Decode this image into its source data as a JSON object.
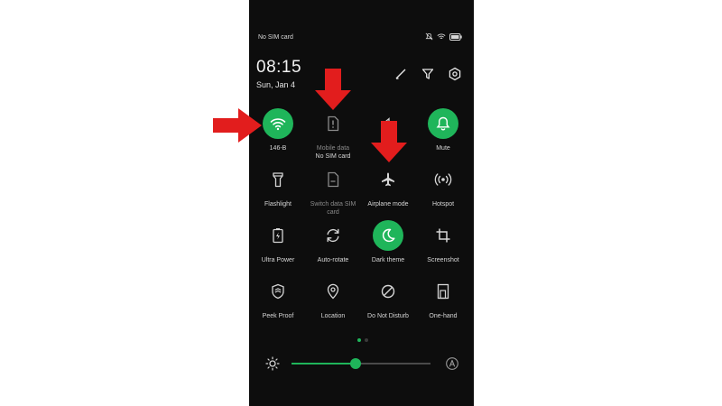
{
  "status_bar": {
    "carrier": "No SIM card",
    "icons": [
      "mute-bell-icon",
      "wifi-icon",
      "battery-icon"
    ]
  },
  "header": {
    "time": "08:15",
    "date": "Sun, Jan 4",
    "actions": [
      "edit-icon",
      "filter-icon",
      "settings-icon"
    ]
  },
  "tiles": [
    {
      "name": "wifi",
      "label": "146-B",
      "sublabel": "",
      "active": true,
      "dim": false
    },
    {
      "name": "mobile-data",
      "label": "Mobile data",
      "sublabel": "No SIM card",
      "active": false,
      "dim": true
    },
    {
      "name": "sound",
      "label": "",
      "sublabel": "",
      "active": false,
      "dim": false
    },
    {
      "name": "mute",
      "label": "Mute",
      "sublabel": "",
      "active": true,
      "dim": false
    },
    {
      "name": "flashlight",
      "label": "Flashlight",
      "sublabel": "",
      "active": false,
      "dim": false
    },
    {
      "name": "switch-data-sim",
      "label": "Switch data SIM card",
      "sublabel": "",
      "active": false,
      "dim": true
    },
    {
      "name": "airplane-mode",
      "label": "Airplane mode",
      "sublabel": "",
      "active": false,
      "dim": false
    },
    {
      "name": "hotspot",
      "label": "Hotspot",
      "sublabel": "",
      "active": false,
      "dim": false
    },
    {
      "name": "ultra-power",
      "label": "Ultra Power",
      "sublabel": "",
      "active": false,
      "dim": false
    },
    {
      "name": "auto-rotate",
      "label": "Auto-rotate",
      "sublabel": "",
      "active": false,
      "dim": false
    },
    {
      "name": "dark-theme",
      "label": "Dark theme",
      "sublabel": "",
      "active": true,
      "dim": false
    },
    {
      "name": "screenshot",
      "label": "Screenshot",
      "sublabel": "",
      "active": false,
      "dim": false
    },
    {
      "name": "peek-proof",
      "label": "Peek Proof",
      "sublabel": "",
      "active": false,
      "dim": false
    },
    {
      "name": "location",
      "label": "Location",
      "sublabel": "",
      "active": false,
      "dim": false
    },
    {
      "name": "do-not-disturb",
      "label": "Do Not Disturb",
      "sublabel": "",
      "active": false,
      "dim": false
    },
    {
      "name": "one-hand",
      "label": "One-hand",
      "sublabel": "",
      "active": false,
      "dim": false
    }
  ],
  "page_indicator": {
    "pages": 2,
    "current": 1
  },
  "brightness": {
    "level": 0.46,
    "auto_icon": "auto-brightness-icon"
  },
  "colors": {
    "accent": "#1fb55a",
    "background": "#0d0d0d",
    "annotation_arrow": "#e21d1d"
  }
}
